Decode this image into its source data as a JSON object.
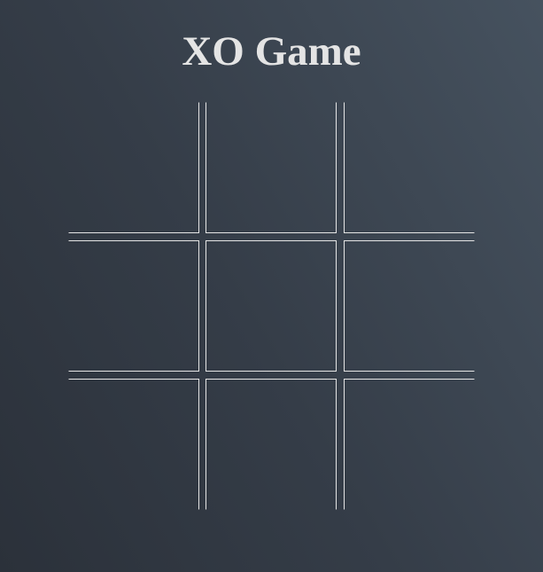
{
  "title": "XO Game",
  "board": {
    "cells": [
      "",
      "",
      "",
      "",
      "",
      "",
      "",
      "",
      ""
    ]
  },
  "colors": {
    "background_start": "#2b313a",
    "background_end": "#46525f",
    "grid_line": "#e6e6e6",
    "title_text": "#e4e4e4"
  }
}
